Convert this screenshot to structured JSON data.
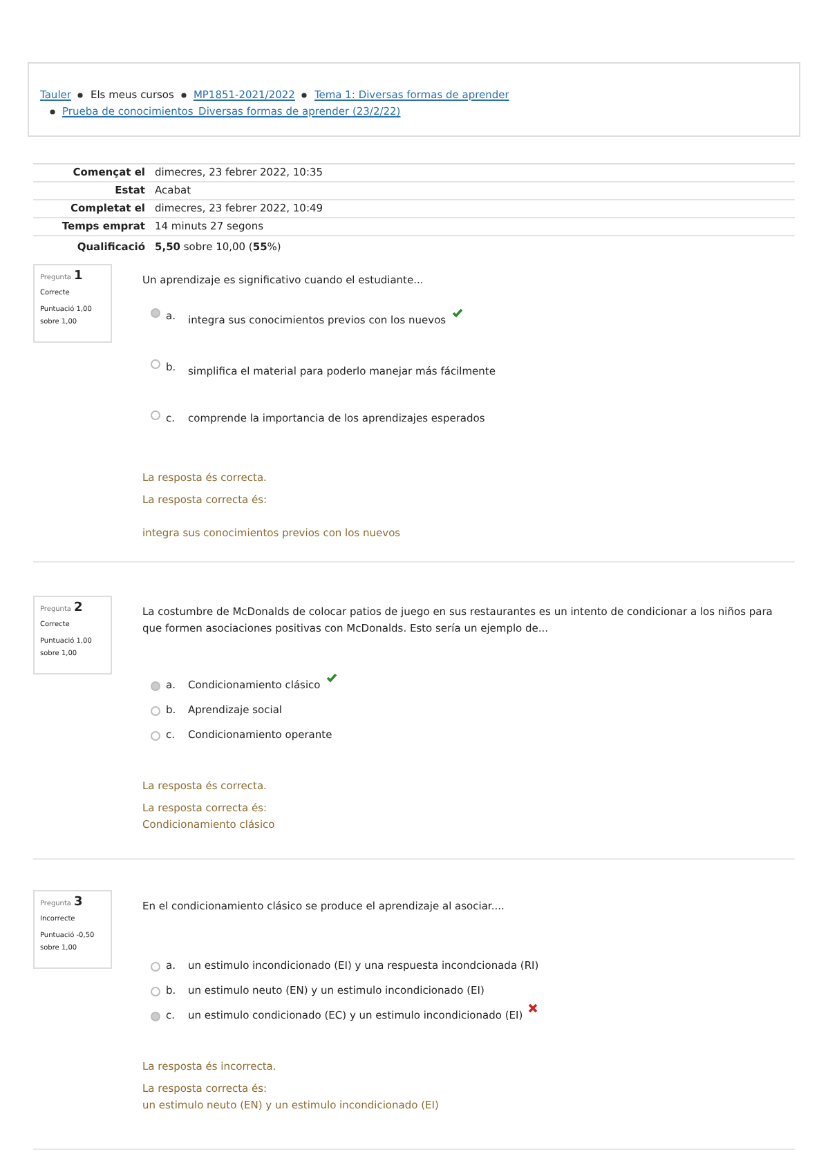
{
  "breadcrumb": {
    "items": [
      {
        "text": "Tauler",
        "link": true
      },
      {
        "text": "Els meus cursos",
        "link": false
      },
      {
        "text": "MP1851-2021/2022",
        "link": true
      },
      {
        "text": "Tema 1: Diversas formas de aprender",
        "link": true
      },
      {
        "text": "Prueba de conocimientos_Diversas formas de aprender (23/2/22)",
        "link": true
      }
    ]
  },
  "summary": [
    {
      "label": "Començat el",
      "value": "dimecres, 23 febrer 2022, 10:35"
    },
    {
      "label": "Estat",
      "value": "Acabat"
    },
    {
      "label": "Completat el",
      "value": "dimecres, 23 febrer 2022, 10:49"
    },
    {
      "label": "Temps emprat",
      "value": "14 minuts 27 segons"
    },
    {
      "label": "Qualificació",
      "value": "**5,50** sobre 10,00 (**55**%)"
    }
  ],
  "questions": [
    {
      "label": "Pregunta",
      "number": "1",
      "status": "Correcte",
      "score": "Puntuació 1,00 sobre 1,00",
      "text": "Un aprendizaje es significativo cuando el estudiante...",
      "options": [
        {
          "letter": "a.",
          "text": "integra sus conocimientos previos con los nuevos",
          "selected": true,
          "tick": true,
          "cross": false
        },
        {
          "letter": "b.",
          "text": "simplifica el material para poderlo manejar más fácilmente",
          "selected": false,
          "tick": false,
          "cross": false
        },
        {
          "letter": "c.",
          "text": "comprende la importancia de los aprendizajes esperados",
          "selected": false,
          "tick": false,
          "cross": false
        }
      ],
      "feedback": "La resposta és correcta.",
      "right_answer_label": "La resposta correcta és:",
      "right_answer": "integra sus conocimientos previos con los nuevos"
    },
    {
      "label": "Pregunta",
      "number": "2",
      "status": "Correcte",
      "score": "Puntuació 1,00 sobre 1,00",
      "text": "La costumbre de McDonalds de colocar patios de juego en sus restaurantes es un intento de condicionar a los niños para que formen asociaciones positivas con McDonalds. Esto sería un ejemplo de...",
      "options": [
        {
          "letter": "a.",
          "text": "Condicionamiento clásico",
          "selected": true,
          "tick": true,
          "cross": false
        },
        {
          "letter": "b.",
          "text": "Aprendizaje social",
          "selected": false,
          "tick": false,
          "cross": false
        },
        {
          "letter": "c.",
          "text": "Condicionamiento operante",
          "selected": false,
          "tick": false,
          "cross": false
        }
      ],
      "feedback": "La resposta és correcta.",
      "right_answer_label": "La resposta correcta és:",
      "right_answer": "Condicionamiento clásico"
    },
    {
      "label": "Pregunta",
      "number": "3",
      "status": "Incorrecte",
      "score": "Puntuació -0,50 sobre 1,00",
      "text": "En el condicionamiento clásico se produce el aprendizaje al asociar....",
      "options": [
        {
          "letter": "a.",
          "text": "un estimulo incondicionado (EI) y una respuesta incondcionada (RI)",
          "selected": false,
          "tick": false,
          "cross": false
        },
        {
          "letter": "b.",
          "text": "un estimulo neuto (EN) y un estimulo incondicionado (EI)",
          "selected": false,
          "tick": false,
          "cross": false
        },
        {
          "letter": "c.",
          "text": "un estimulo condicionado (EC) y un estimulo incondicionado (EI)",
          "selected": true,
          "tick": false,
          "cross": true
        }
      ],
      "feedback": "La resposta és incorrecta.",
      "right_answer_label": "La resposta correcta és:",
      "right_answer": "un estimulo neuto (EN) y un estimulo incondicionado (EI)"
    }
  ]
}
